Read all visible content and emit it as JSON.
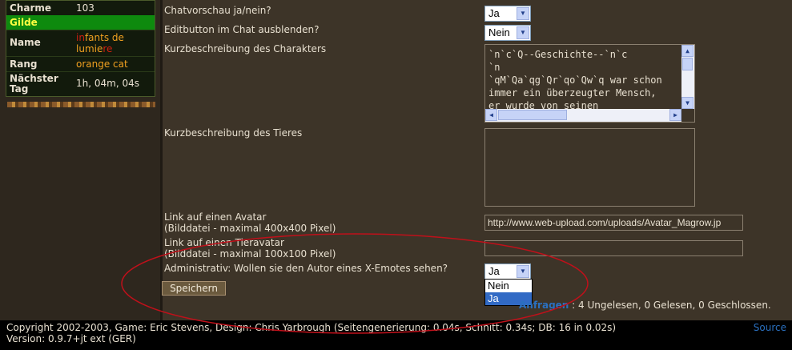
{
  "stats": {
    "charme_label": "Charme",
    "charme_value": "103",
    "gilde_label": "Gilde",
    "name_label": "Name",
    "name_value_a": "in",
    "name_value_b": "fants de",
    "name_value_c": "lumie",
    "name_value_d": "re",
    "rang_label": "Rang",
    "rang_value": "orange cat",
    "next_label": "Nächster Tag",
    "next_value": "1h, 04m, 04s"
  },
  "form": {
    "chatvorschau_label": "Chatvorschau ja/nein?",
    "chatvorschau_value": "Ja",
    "editbutton_label": "Editbutton im Chat ausblenden?",
    "editbutton_value": "Nein",
    "kurz_char_label": "Kurzbeschreibung des Charakters",
    "kurz_char_text": "`n`c`Q--Geschichte--`n`c\n`n\n`qM`Qa`qg`Qr`qo`Qw`q war schon\nimmer ein überzeugter Mensch,\ner wurde von seinen",
    "kurz_tier_label": "Kurzbeschreibung des Tieres",
    "avatar_label": "Link auf einen Avatar",
    "avatar_hint": "(Bilddatei - maximal 400x400 Pixel)",
    "avatar_value": "http://www.web-upload.com/uploads/Avatar_Magrow.jp",
    "tieravatar_label": "Link auf einen Tieravatar",
    "tieravatar_hint": "(Bilddatei - maximal 100x100 Pixel)",
    "admin_label": "Administrativ: Wollen sie den Autor eines X-Emotes sehen?",
    "admin_value": "Ja",
    "admin_options": [
      "Nein",
      "Ja"
    ],
    "save_label": "Speichern"
  },
  "anfragen": {
    "link": "Anfragen",
    "text": ": 4 Ungelesen, 0 Gelesen, 0 Geschlossen."
  },
  "footer": {
    "line1": "Copyright 2002-2003, Game: Eric Stevens, Design: Chris Yarbrough (Seitengenerierung: 0.04s, Schnitt: 0.34s; DB: 16 in 0.02s)",
    "line2": "Version: 0.9.7+jt ext (GER)",
    "source": "Source"
  },
  "colors": {
    "background": "#3d3428",
    "gilde_bar": "#0e8a0e",
    "annotation_ellipse": "#c0101a",
    "link_blue": "#2a70c0"
  }
}
